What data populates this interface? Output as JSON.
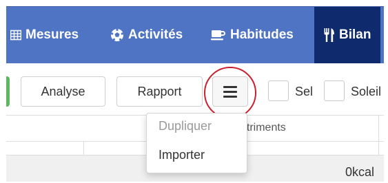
{
  "navbar": {
    "items": [
      {
        "label": "Mesures",
        "icon": "table-icon"
      },
      {
        "label": "Activités",
        "icon": "soccer-ball-icon"
      },
      {
        "label": "Habitudes",
        "icon": "coffee-cup-icon"
      },
      {
        "label": "Bilan",
        "icon": "fork-knife-icon",
        "active": true
      }
    ],
    "colors": {
      "background": "#4f74c4",
      "active_background": "#0f2b6e"
    }
  },
  "toolbar": {
    "analyse_label": "Analyse",
    "rapport_label": "Rapport",
    "menu_icon": "hamburger-menu-icon",
    "checkbox1_label": "Sel",
    "checkbox2_label": "Soleil"
  },
  "dropdown": {
    "items": [
      {
        "label": "Dupliquer",
        "disabled": true
      },
      {
        "label": "Importer",
        "disabled": false
      }
    ]
  },
  "table": {
    "column_header_partial": "utriments",
    "kcal_value": "0kcal"
  },
  "accent_colors": {
    "highlight_circle": "#cc1f2e",
    "green_button": "#5cb85c"
  }
}
